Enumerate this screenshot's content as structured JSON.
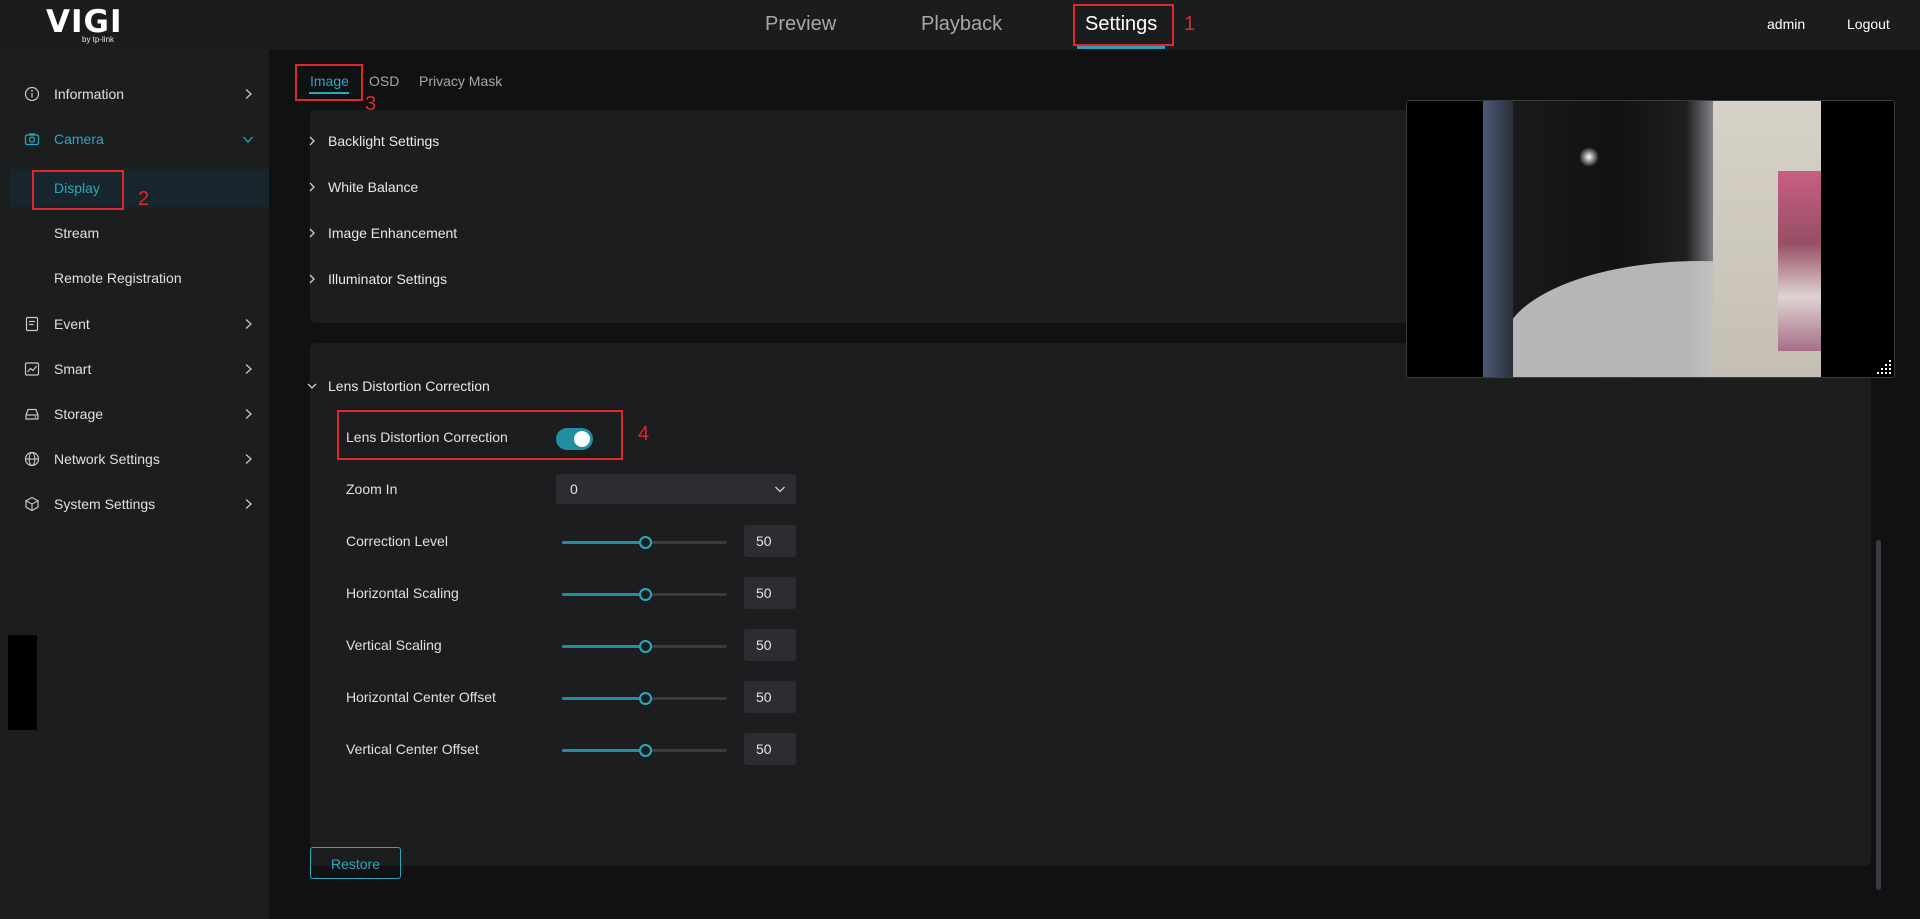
{
  "header": {
    "logo_text": "VIGI",
    "logo_sub": "by tp-link",
    "tabs": [
      {
        "label": "Preview"
      },
      {
        "label": "Playback"
      },
      {
        "label": "Settings"
      }
    ],
    "active_tab": "Settings",
    "user": "admin",
    "logout_label": "Logout"
  },
  "sidebar": {
    "items": [
      {
        "label": "Information",
        "icon": "info-icon"
      },
      {
        "label": "Camera",
        "icon": "camera-icon",
        "expanded": true
      },
      {
        "label": "Event",
        "icon": "event-icon"
      },
      {
        "label": "Smart",
        "icon": "smart-icon"
      },
      {
        "label": "Storage",
        "icon": "storage-icon"
      },
      {
        "label": "Network Settings",
        "icon": "globe-icon"
      },
      {
        "label": "System Settings",
        "icon": "cube-icon"
      }
    ],
    "camera_subitems": [
      {
        "label": "Display",
        "active": true
      },
      {
        "label": "Stream"
      },
      {
        "label": "Remote Registration"
      }
    ]
  },
  "subtabs": [
    {
      "label": "Image"
    },
    {
      "label": "OSD"
    },
    {
      "label": "Privacy Mask"
    }
  ],
  "active_subtab": "Image",
  "image_sections": [
    {
      "label": "Backlight Settings"
    },
    {
      "label": "White Balance"
    },
    {
      "label": "Image Enhancement"
    },
    {
      "label": "Illuminator Settings"
    }
  ],
  "lens": {
    "section_title": "Lens Distortion Correction",
    "toggle_label": "Lens Distortion Correction",
    "toggle_on": true,
    "zoom_label": "Zoom In",
    "zoom_value": "0",
    "sliders": [
      {
        "label": "Correction Level",
        "value": "50",
        "fraction": 0.5
      },
      {
        "label": "Horizontal Scaling",
        "value": "50",
        "fraction": 0.5
      },
      {
        "label": "Vertical Scaling",
        "value": "50",
        "fraction": 0.5
      },
      {
        "label": "Horizontal Center Offset",
        "value": "50",
        "fraction": 0.5
      },
      {
        "label": "Vertical Center Offset",
        "value": "50",
        "fraction": 0.5
      }
    ]
  },
  "restore_label": "Restore",
  "annotations": [
    {
      "num": "1",
      "target": "settings-tab"
    },
    {
      "num": "2",
      "target": "display-item"
    },
    {
      "num": "3",
      "target": "image-tab"
    },
    {
      "num": "4",
      "target": "lens-toggle-row"
    }
  ],
  "colors": {
    "accent": "#2aa9be",
    "annotation": "#e0262e",
    "background": "#0f1113",
    "panel": "#1c1d1f"
  }
}
